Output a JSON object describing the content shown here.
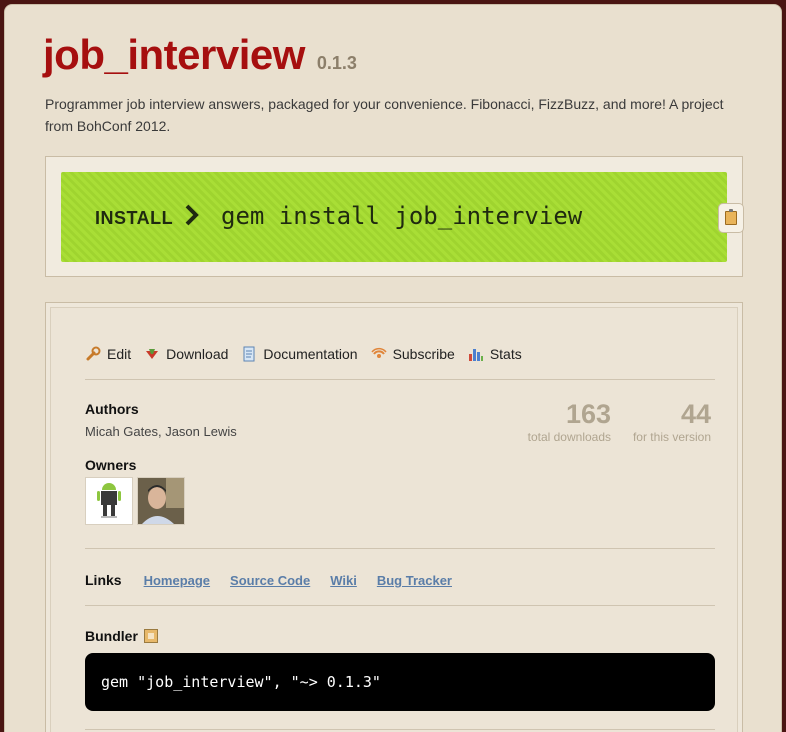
{
  "gem": {
    "name": "job_interview",
    "version": "0.1.3",
    "description": "Programmer job interview answers, packaged for your convenience. Fibonacci, FizzBuzz, and more! A project from BohConf 2012."
  },
  "install": {
    "label": "INSTALL",
    "chevron": "›",
    "command": "gem install job_interview",
    "copy_icon": "clipboard-icon"
  },
  "actions": [
    {
      "label": "Edit",
      "icon": "wrench-icon"
    },
    {
      "label": "Download",
      "icon": "download-icon"
    },
    {
      "label": "Documentation",
      "icon": "document-icon"
    },
    {
      "label": "Subscribe",
      "icon": "rss-icon"
    },
    {
      "label": "Stats",
      "icon": "bar-chart-icon"
    }
  ],
  "authors": {
    "heading": "Authors",
    "names": "Micah Gates, Jason Lewis"
  },
  "stats": {
    "total_downloads": "163",
    "total_label": "total downloads",
    "version_downloads": "44",
    "version_label": "for this version"
  },
  "owners": {
    "heading": "Owners",
    "avatars": [
      "android-avatar",
      "person-avatar"
    ]
  },
  "links": {
    "heading": "Links",
    "items": [
      "Homepage",
      "Source Code",
      "Wiki",
      "Bug Tracker"
    ]
  },
  "bundler": {
    "heading": "Bundler",
    "code": "gem \"job_interview\", \"~> 0.1.3\""
  },
  "colors": {
    "title": "#a60f0f",
    "install_green": "#a4da32",
    "link": "#5a7da8",
    "stat": "#b0a590"
  }
}
